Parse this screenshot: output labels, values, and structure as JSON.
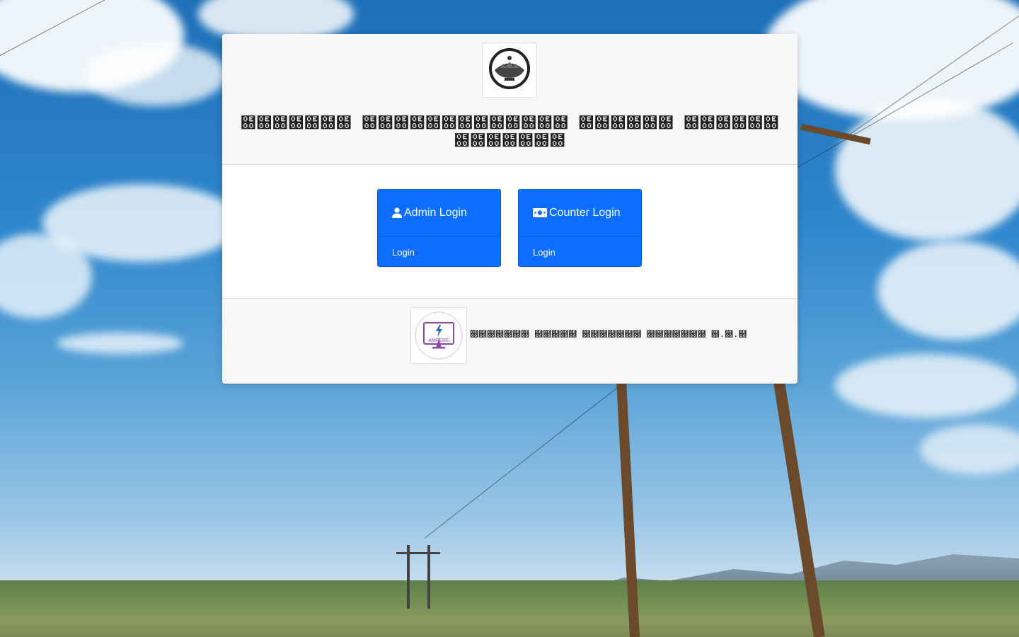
{
  "header": {
    "logo_icon": "organization-emblem-icon",
    "title": "฀฀฀฀฀฀฀ ฀฀฀฀฀฀฀฀฀฀฀฀฀ ฀฀฀฀฀฀ ฀฀฀฀฀฀ ฀฀฀฀฀฀฀"
  },
  "logins": [
    {
      "title": "Admin Login",
      "action": "Login",
      "icon": "user-icon"
    },
    {
      "title": "Counter Login",
      "action": "Login",
      "icon": "money-bill-icon"
    }
  ],
  "footer": {
    "brand_logo_text": "AMPERE",
    "brand_icon": "monitor-lightning-icon",
    "text": "฀฀฀฀฀฀฀ ฀฀฀฀฀ ฀฀฀฀฀฀฀ ฀฀฀฀฀฀฀ ฀.฀.฀"
  },
  "colors": {
    "primary": "#0d6efd",
    "card_bg": "#f7f7f7",
    "sky": "#2f86cc",
    "brand_purple": "#8e44ad"
  }
}
